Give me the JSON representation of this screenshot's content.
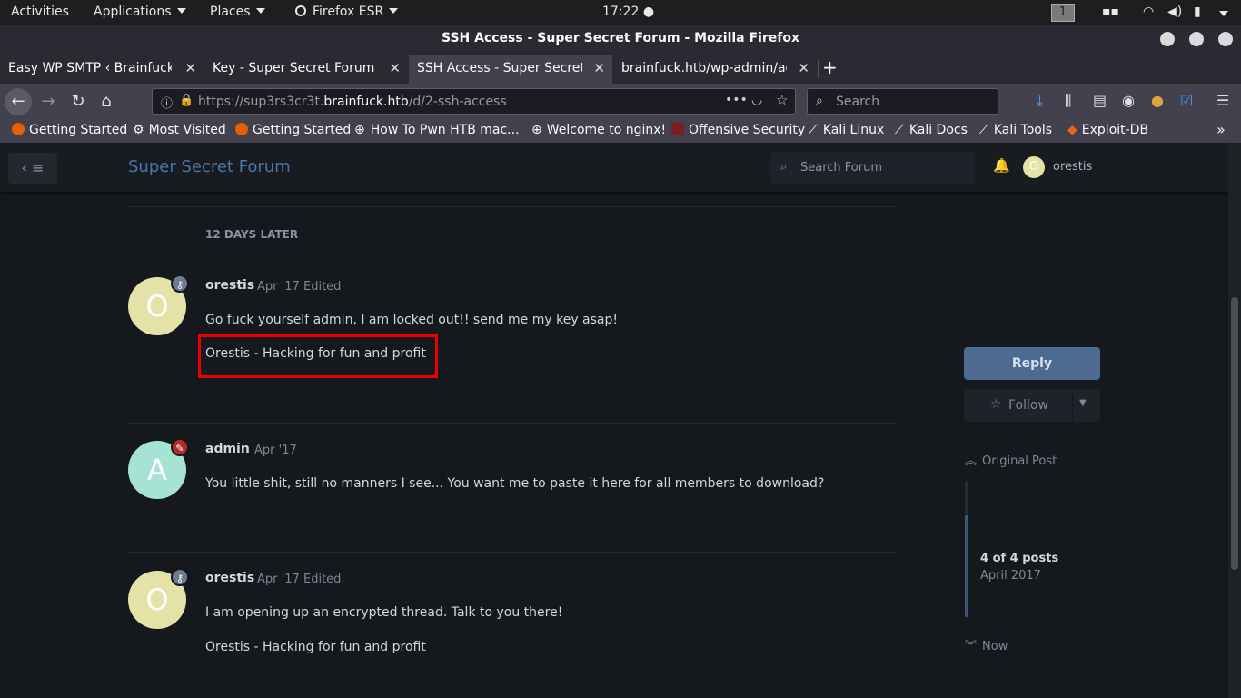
{
  "gnome": {
    "activities": "Activities",
    "applications": "Applications",
    "places": "Places",
    "app": "Firefox ESR",
    "clock": "17:22",
    "workspace": "1"
  },
  "window": {
    "title": "SSH Access - Super Secret Forum - Mozilla Firefox"
  },
  "tabs": [
    {
      "label": "Easy WP SMTP ‹ Brainfuck L"
    },
    {
      "label": "Key - Super Secret Forum"
    },
    {
      "label": "SSH Access - Super Secret F"
    },
    {
      "label": "brainfuck.htb/wp-admin/adm"
    }
  ],
  "url": {
    "prefix": "https://sup3rs3cr3t.",
    "host": "brainfuck.htb",
    "path": "/d/2-ssh-access"
  },
  "search": {
    "placeholder": "Search"
  },
  "bookmarks": [
    {
      "label": "Getting Started"
    },
    {
      "label": "Most Visited"
    },
    {
      "label": "Getting Started"
    },
    {
      "label": "How To Pwn HTB mac..."
    },
    {
      "label": "Welcome to nginx!"
    },
    {
      "label": "Offensive Security"
    },
    {
      "label": "Kali Linux"
    },
    {
      "label": "Kali Docs"
    },
    {
      "label": "Kali Tools"
    },
    {
      "label": "Exploit-DB"
    }
  ],
  "forum": {
    "title": "Super Secret Forum",
    "search_placeholder": "Search Forum",
    "user": "orestis",
    "user_initial": "O",
    "time_gap": "12 DAYS LATER"
  },
  "posts": [
    {
      "user": "orestis",
      "initial": "O",
      "date": "Apr '17",
      "edited": "Edited",
      "body": "Go fuck yourself admin, I am locked out!! send me my key asap!",
      "signature": "Orestis - Hacking for fun and profit"
    },
    {
      "user": "admin",
      "initial": "A",
      "date": "Apr '17",
      "body": "You little shit, still no manners I see... You want me to paste it here for all members to download?"
    },
    {
      "user": "orestis",
      "initial": "O",
      "date": "Apr '17",
      "edited": "Edited",
      "body": "I am opening up an encrypted thread. Talk to you there!",
      "signature": "Orestis - Hacking for fun and profit"
    }
  ],
  "sidebar": {
    "reply": "Reply",
    "follow": "Follow",
    "original_post": "Original Post",
    "post_count": "4 of 4 posts",
    "month": "April 2017",
    "now": "Now"
  },
  "colors": {
    "avatar_orestis": "#e5e2a8",
    "avatar_admin": "#a7e3d2",
    "badge_user": "#6e7c91",
    "badge_admin": "#b72a2a",
    "accent": "#4d76a8",
    "highlight_box": "#ee0000"
  }
}
